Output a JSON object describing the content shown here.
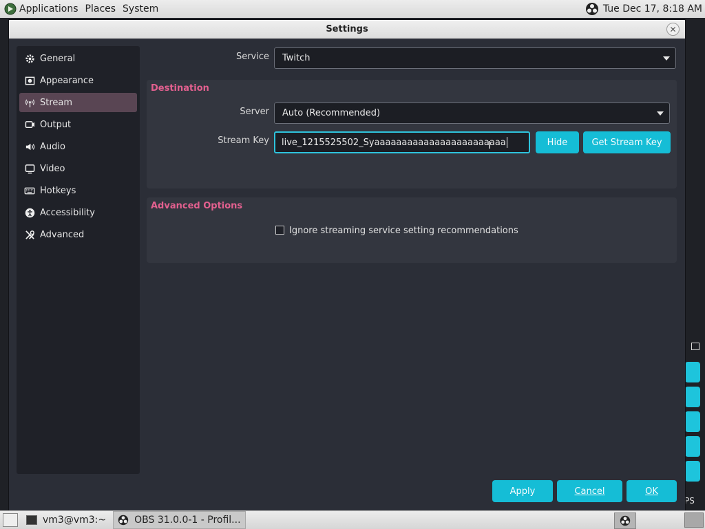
{
  "top_panel": {
    "menu": [
      "Applications",
      "Places",
      "System"
    ],
    "clock": "Tue Dec 17,  8:18 AM"
  },
  "window": {
    "title": "Settings"
  },
  "sidebar": {
    "items": [
      {
        "label": "General",
        "icon": "gear-icon"
      },
      {
        "label": "Appearance",
        "icon": "appearance-icon"
      },
      {
        "label": "Stream",
        "icon": "antenna-icon",
        "selected": true
      },
      {
        "label": "Output",
        "icon": "output-icon"
      },
      {
        "label": "Audio",
        "icon": "speaker-icon"
      },
      {
        "label": "Video",
        "icon": "monitor-icon"
      },
      {
        "label": "Hotkeys",
        "icon": "keyboard-icon"
      },
      {
        "label": "Accessibility",
        "icon": "accessibility-icon"
      },
      {
        "label": "Advanced",
        "icon": "tools-icon"
      }
    ]
  },
  "stream": {
    "service_label": "Service",
    "service_value": "Twitch",
    "destination": {
      "title": "Destination",
      "server_label": "Server",
      "server_value": "Auto (Recommended)",
      "stream_key_label": "Stream Key",
      "stream_key_value": "live_1215525502_Syaaaaaaaaaaaaaaaaaaaaaaaa",
      "hide_label": "Hide",
      "get_key_label": "Get Stream Key"
    },
    "advanced": {
      "title": "Advanced Options",
      "ignore_checkbox_label": "Ignore streaming service setting recommendations",
      "ignore_checked": false
    }
  },
  "footer": {
    "apply": "Apply",
    "cancel": "Cancel",
    "ok": "OK"
  },
  "taskbar": {
    "tasks": [
      {
        "label": "vm3@vm3:~"
      },
      {
        "label": "OBS 31.0.0-1 - Profil..."
      }
    ]
  },
  "background": {
    "status_fragment": "PS"
  },
  "colors": {
    "accent": "#15bdd6",
    "group_title": "#e3608f",
    "selected_item": "#594553",
    "window_bg": "#2b2e37"
  }
}
